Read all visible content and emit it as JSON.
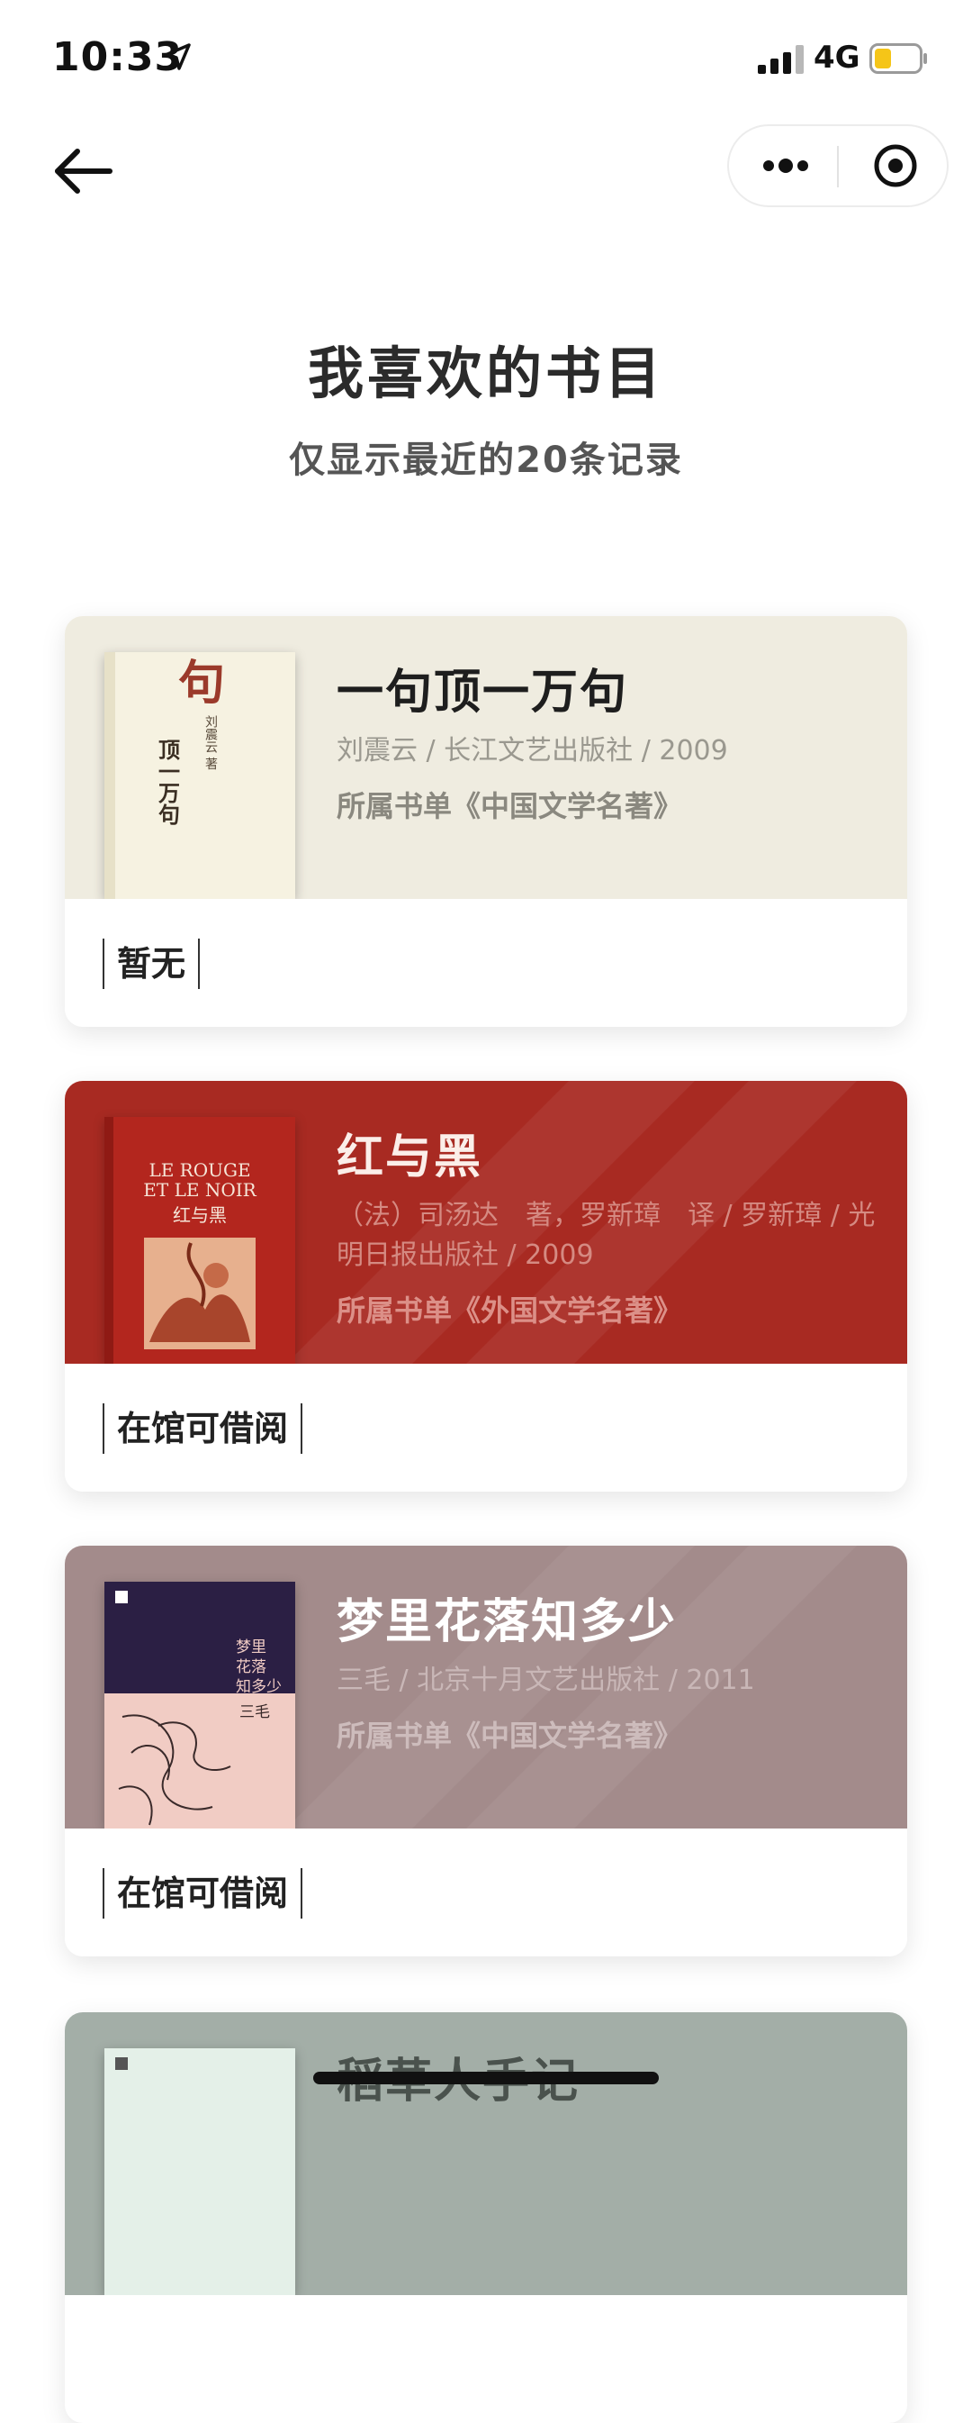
{
  "status_bar": {
    "time": "10:33",
    "network": "4G",
    "icons": [
      "location-arrow-icon",
      "signal-bars-icon",
      "battery-icon"
    ],
    "battery_color": "#f5c518"
  },
  "nav": {
    "back_icon": "arrow-left-icon",
    "more_icon": "more-dots-icon",
    "close_icon": "target-circle-icon"
  },
  "header": {
    "title": "我喜欢的书目",
    "subtitle": "仅显示最近的20条记录"
  },
  "books": [
    {
      "title": "一句顶一万句",
      "meta": "刘震云 / 长江文艺出版社 / 2009",
      "list": "所属书单《中国文学名著》",
      "status": "暂无",
      "theme_color": "#efece0",
      "cover_text": [
        "句",
        "顶一万句",
        "刘震云 著"
      ]
    },
    {
      "title": "红与黑",
      "meta": "（法）司汤达　著，罗新璋　译 / 罗新璋 / 光明日报出版社 / 2009",
      "list": "所属书单《外国文学名著》",
      "status": "在馆可借阅",
      "theme_color": "#a82a22",
      "cover_text": [
        "LE ROUGE",
        "ET LE NOIR",
        "红与黑"
      ]
    },
    {
      "title": "梦里花落知多少",
      "meta": "三毛 / 北京十月文艺出版社 / 2011",
      "list": "所属书单《中国文学名著》",
      "status": "在馆可借阅",
      "theme_color": "#a38b8b",
      "cover_text": [
        "梦里",
        "花落",
        "知多少",
        "三毛"
      ]
    },
    {
      "title": "稻草人手记",
      "theme_color": "#a3aea7"
    }
  ]
}
